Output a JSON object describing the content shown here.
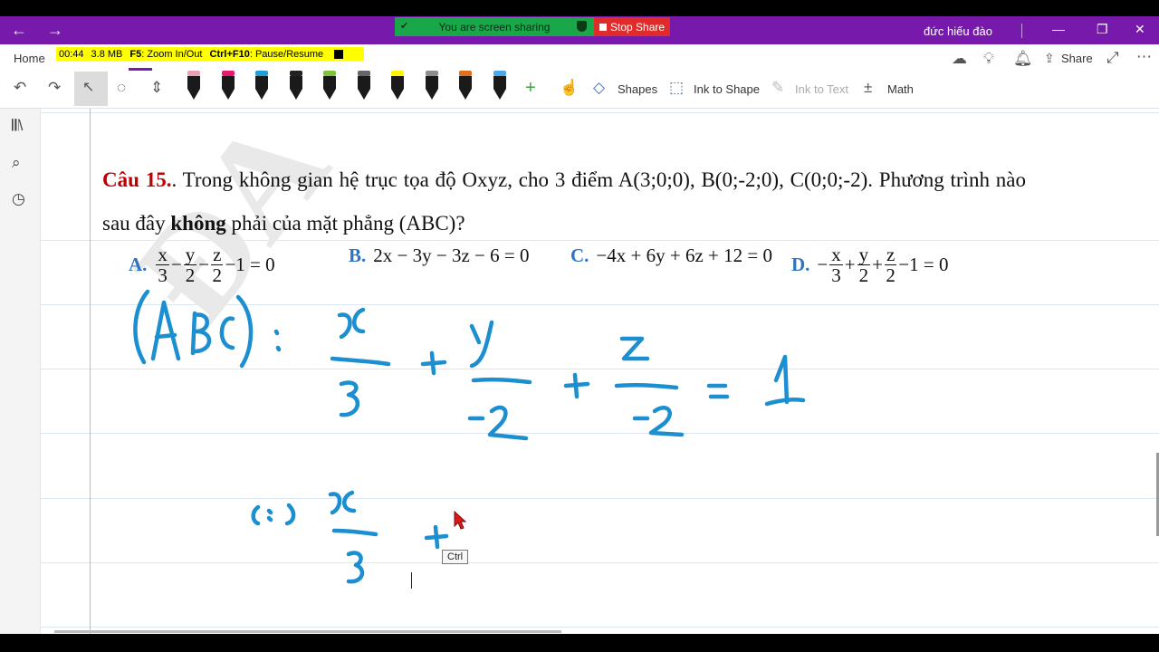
{
  "titlebar": {
    "back_icon": "←",
    "forward_icon": "→",
    "sharing_text": "You are screen sharing",
    "stop_share_label": "Stop Share",
    "user_name": "đức hiếu đào",
    "colors": {
      "accent": "#7719aa",
      "share_green": "#1aa74a",
      "stop_red": "#e02b2b"
    }
  },
  "recorder": {
    "time": "00:44",
    "size": "3.8 MB",
    "zoom_hint_key": "F5",
    "zoom_hint": "Zoom In/Out",
    "pause_hint_key": "Ctrl+F10",
    "pause_hint": "Pause/Resume"
  },
  "ribbon": {
    "home_tab": "Home",
    "share_label": "Share",
    "shapes_label": "Shapes",
    "ink_to_shape_label": "Ink to Shape",
    "ink_to_text_label": "Ink to Text",
    "math_label": "Math",
    "pens": [
      {
        "color": "#e8a0b4"
      },
      {
        "color": "#e8196e"
      },
      {
        "color": "#1f9fd8"
      },
      {
        "color": "#222222"
      },
      {
        "color": "#7dc53f"
      },
      {
        "color": "#666666"
      },
      {
        "color": "#fff200"
      },
      {
        "color": "#8d8d8d"
      },
      {
        "color": "#e07020"
      },
      {
        "color": "#4aa8e8"
      }
    ]
  },
  "question": {
    "number": "Câu 15.",
    "text_before_bold": ". Trong không gian hệ trục tọa độ Oxyz, cho 3 điểm A(3;0;0), B(0;-2;0), C(0;0;-2). Phương trình nào sau đây ",
    "bold_word": "không",
    "text_after_bold": " phải của mặt phẳng (ABC)?",
    "options": {
      "a_letter": "A.",
      "a_x": "x",
      "a_3": "3",
      "a_minus1": "−",
      "a_y": "y",
      "a_2a": "2",
      "a_minus2": "−",
      "a_z": "z",
      "a_2b": "2",
      "a_tail": "−1 = 0",
      "b_letter": "B.",
      "b_expr": "2x − 3y − 3z − 6 = 0",
      "c_letter": "C.",
      "c_expr": "−4x + 6y + 6z + 12 = 0",
      "d_letter": "D.",
      "d_lead": "−",
      "d_x": "x",
      "d_3": "3",
      "d_plus1": "+",
      "d_y": "y",
      "d_2a": "2",
      "d_plus2": "+",
      "d_z": "z",
      "d_2b": "2",
      "d_tail": "−1 = 0"
    }
  },
  "tooltip": {
    "ctrl": "Ctrl"
  },
  "ink_color": "#1b8fd0"
}
